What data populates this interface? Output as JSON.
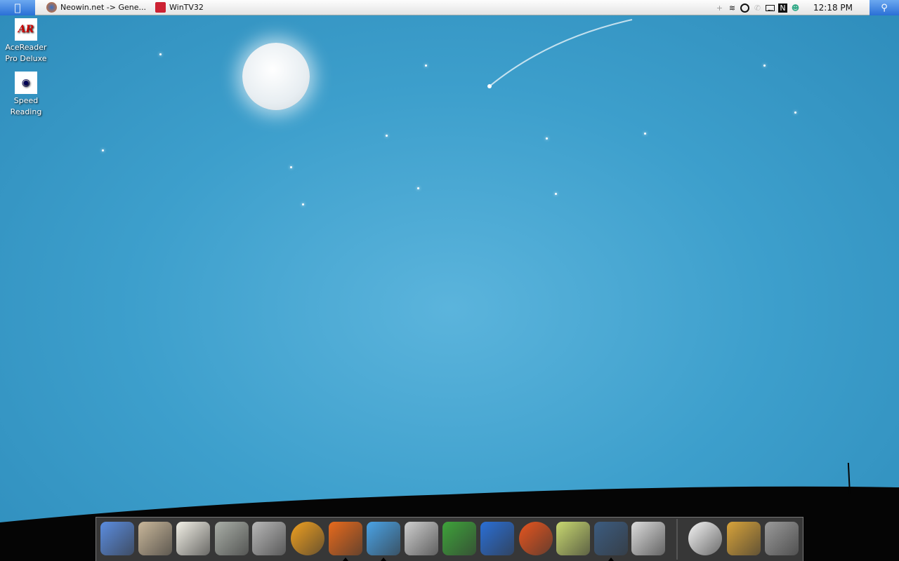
{
  "menubar": {
    "apple_icon": "apple-logo-icon",
    "tasks": [
      {
        "label": "Neowin.net -> Gene...",
        "icon": "firefox-icon"
      },
      {
        "label": "WinTV32",
        "icon": "wintv-icon"
      }
    ],
    "tray": {
      "icons": [
        "plus-icon",
        "wifi-icon",
        "sync-icon",
        "phone-icon",
        "battery-icon",
        "n-app-icon",
        "messenger-icon"
      ],
      "clock": "12:18 PM"
    },
    "spotlight_icon": "search-icon"
  },
  "desktop": {
    "icons": [
      {
        "label": "AceReader Pro Deluxe",
        "glyph": "AR"
      },
      {
        "label": "Speed Reading",
        "glyph": "◉"
      }
    ]
  },
  "dock": {
    "items": [
      {
        "name": "finder",
        "color": "#5b8de0",
        "running": false
      },
      {
        "name": "home",
        "color": "#c9b79a",
        "running": false
      },
      {
        "name": "textedit",
        "color": "#f2f0e6",
        "running": false
      },
      {
        "name": "calculator",
        "color": "#a9aea7",
        "running": false
      },
      {
        "name": "dvd-player",
        "color": "#b8b8b8",
        "running": false
      },
      {
        "name": "media-player",
        "color": "#f0a020",
        "running": false
      },
      {
        "name": "firefox",
        "color": "#e86a1c",
        "running": true
      },
      {
        "name": "messenger",
        "color": "#4aa3e6",
        "running": true
      },
      {
        "name": "tuxedo",
        "color": "#cfcfcf",
        "running": false
      },
      {
        "name": "excel",
        "color": "#3ea33a",
        "running": false
      },
      {
        "name": "word",
        "color": "#2a6fd6",
        "running": false
      },
      {
        "name": "burner",
        "color": "#e8551e",
        "running": false
      },
      {
        "name": "paint",
        "color": "#c8d870",
        "running": false
      },
      {
        "name": "display",
        "color": "#3c5c80",
        "running": true
      },
      {
        "name": "system-preferences",
        "color": "#dcdcdc",
        "running": false
      },
      {
        "name": "clock",
        "color": "#f5f5f5",
        "running": false
      },
      {
        "name": "battery",
        "color": "#d8a33a",
        "running": false
      },
      {
        "name": "trash",
        "color": "#9a9a9a",
        "running": false
      }
    ]
  }
}
